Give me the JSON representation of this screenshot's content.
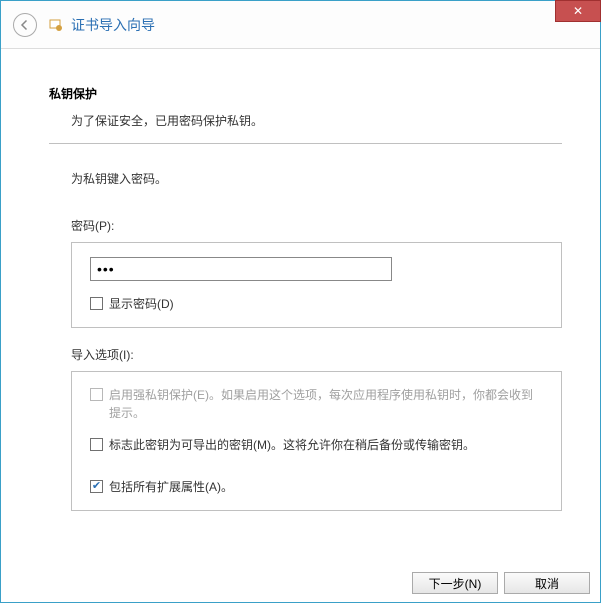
{
  "window": {
    "title": "证书导入向导"
  },
  "section": {
    "title": "私钥保护",
    "description": "为了保证安全，已用密码保护私钥。"
  },
  "prompt": "为私钥键入密码。",
  "password": {
    "label": "密码(P):",
    "value": "•••",
    "show_label": "显示密码(D)"
  },
  "import_options": {
    "label": "导入选项(I):",
    "strong_protect": "启用强私钥保护(E)。如果启用这个选项，每次应用程序使用私钥时，你都会收到提示。",
    "mark_exportable": "标志此密钥为可导出的密钥(M)。这将允许你在稍后备份或传输密钥。",
    "include_ext": "包括所有扩展属性(A)。"
  },
  "buttons": {
    "next": "下一步(N)",
    "cancel": "取消"
  }
}
